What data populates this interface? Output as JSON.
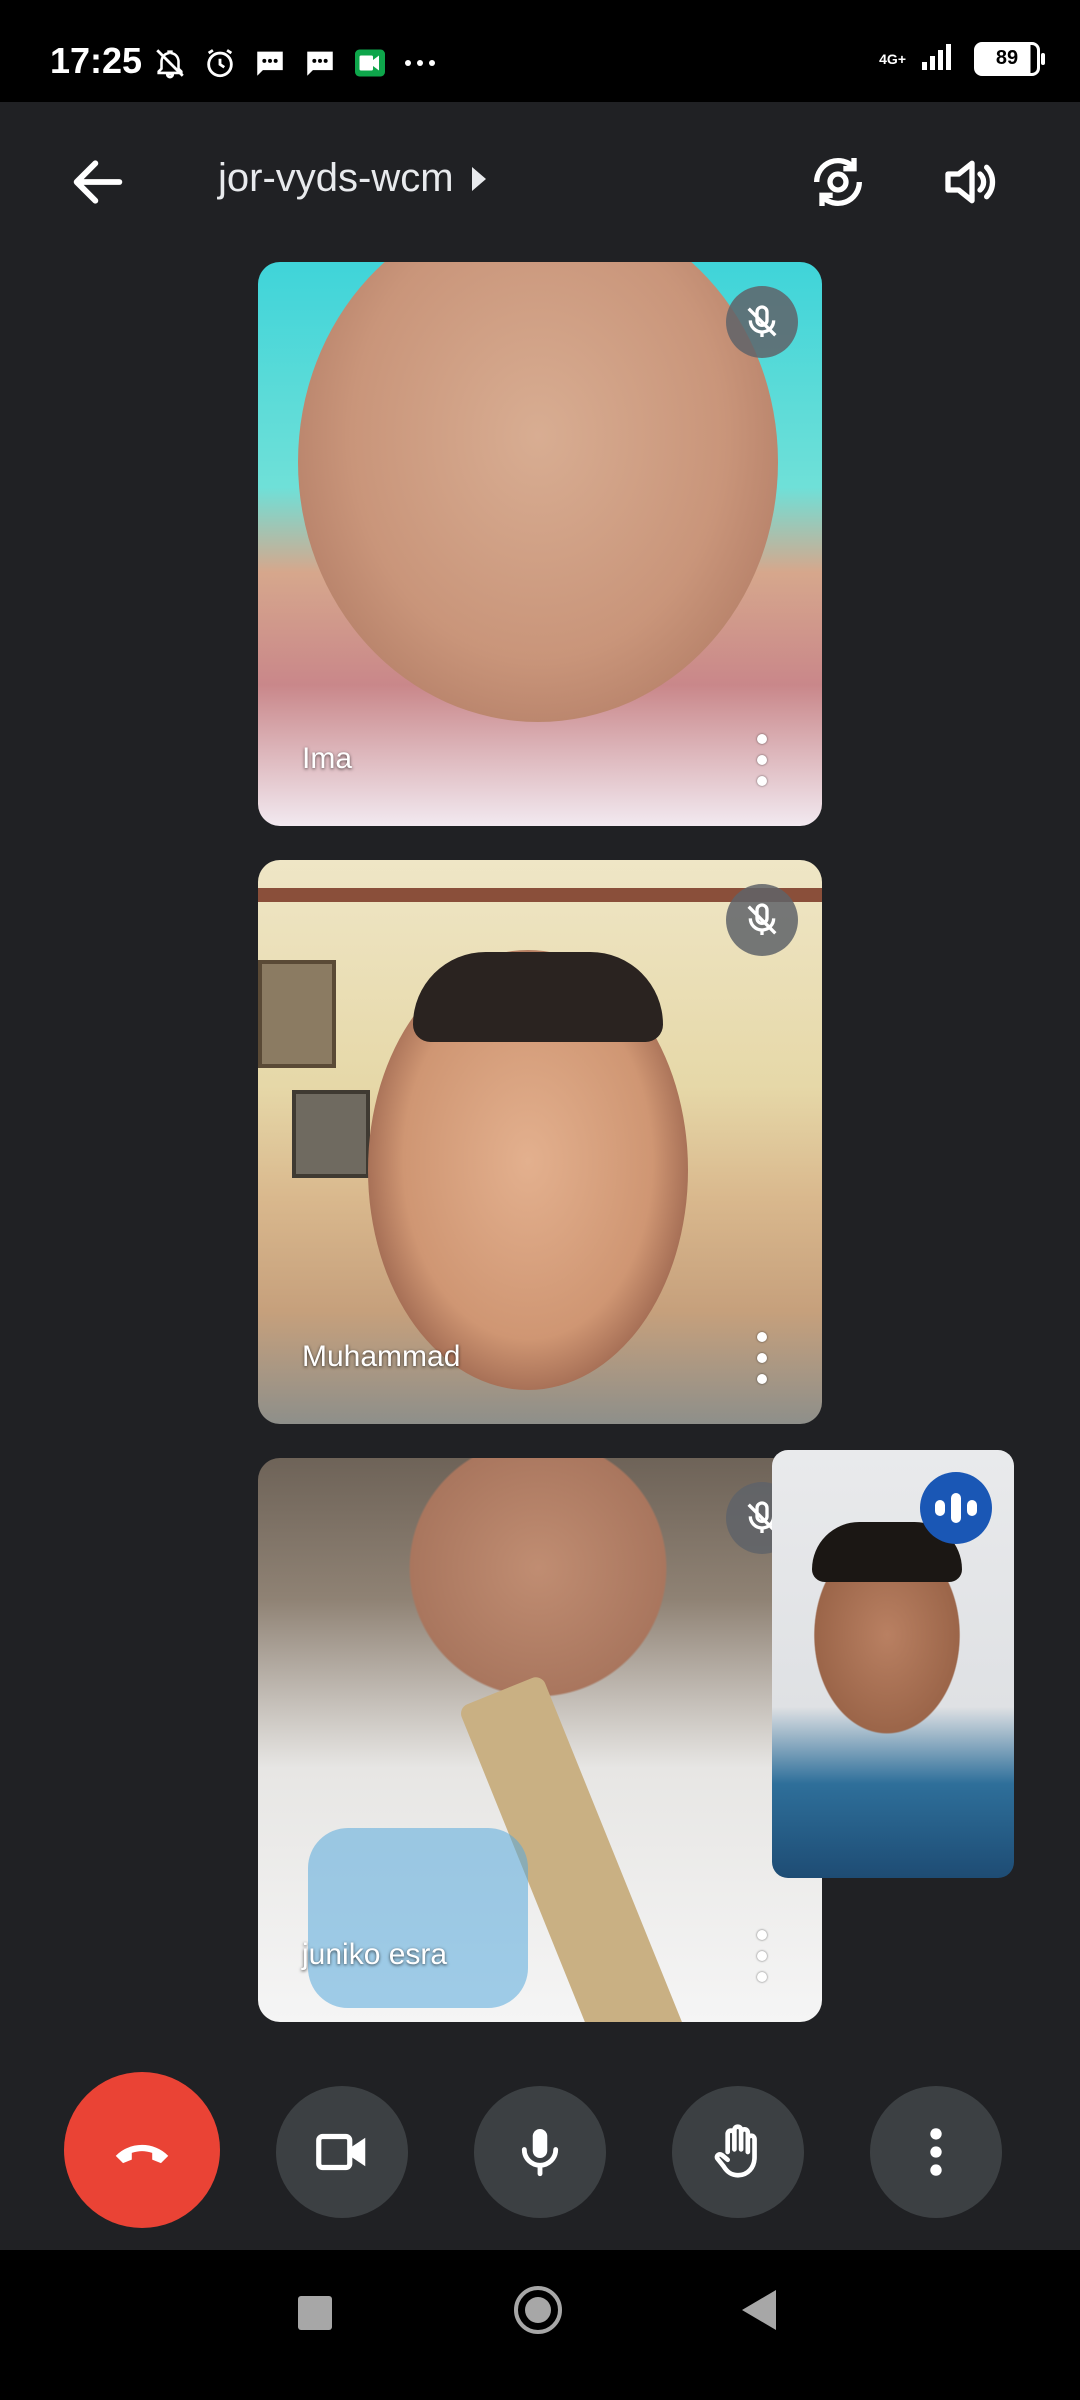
{
  "status_bar": {
    "time": "17:25",
    "network": "4G+",
    "battery": "89",
    "icons": [
      "muted-bell-icon",
      "alarm-icon",
      "message-icon",
      "message-icon",
      "meet-icon",
      "more-dots-icon"
    ]
  },
  "top_bar": {
    "meeting_code": "jor-vyds-wcm"
  },
  "participants": [
    {
      "name": "Ima",
      "muted": true
    },
    {
      "name": "Muhammad",
      "muted": true
    },
    {
      "name": "juniko esra",
      "muted": true
    }
  ],
  "self_preview": {
    "speaking": true
  },
  "controls": [
    "end-call",
    "camera",
    "microphone",
    "raise-hand",
    "more-options"
  ],
  "colors": {
    "end_call": "#ea4335",
    "control_bg": "#3c4043",
    "speaking_badge": "#1a57b5"
  }
}
